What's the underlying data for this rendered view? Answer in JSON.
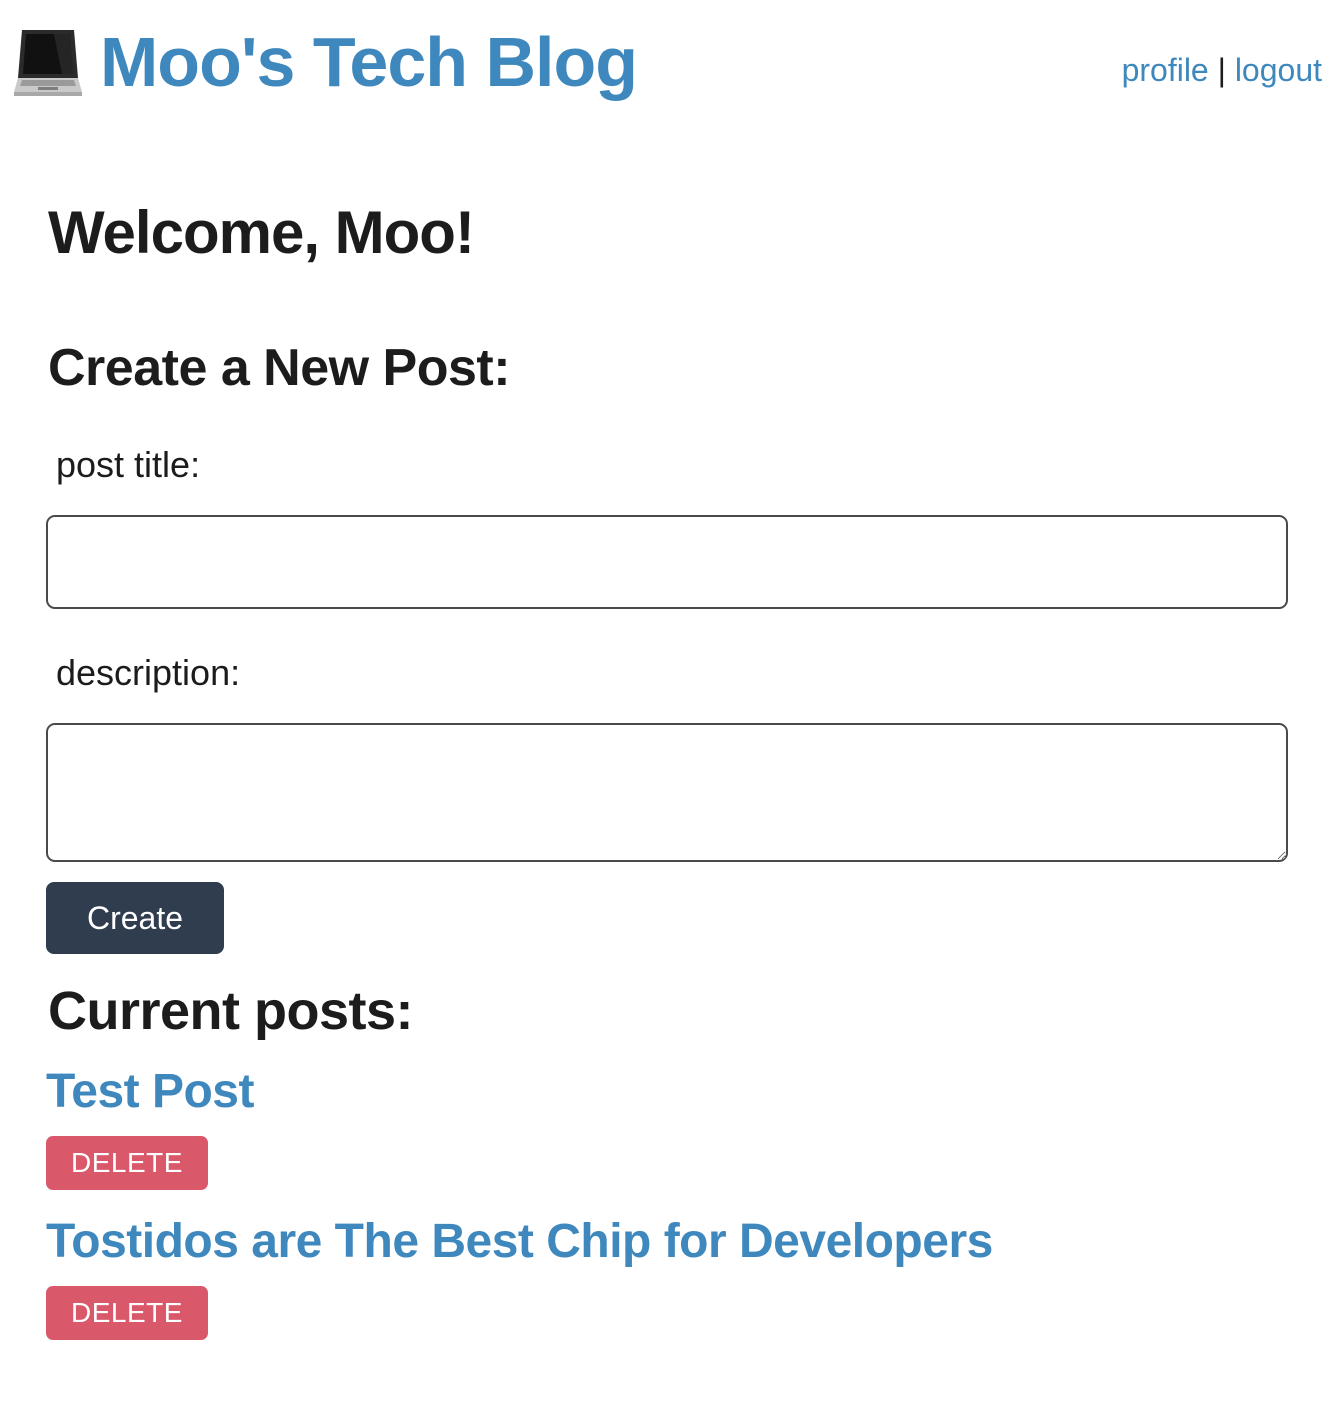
{
  "header": {
    "site_title": "Moo's Tech Blog",
    "logo_icon": "laptop-icon",
    "nav": {
      "profile_label": "profile",
      "separator": "|",
      "logout_label": "logout"
    }
  },
  "main": {
    "welcome": "Welcome, Moo!",
    "create_heading": "Create a New Post:",
    "form": {
      "title_label": "post title:",
      "title_value": "",
      "description_label": "description:",
      "description_value": "",
      "create_label": "Create"
    },
    "posts_heading": "Current posts:",
    "posts": [
      {
        "title": "Test Post",
        "delete_label": "DELETE"
      },
      {
        "title": "Tostidos are The Best Chip for Developers",
        "delete_label": "DELETE"
      }
    ]
  },
  "colors": {
    "link": "#3f88bd",
    "primary_button": "#2f3d4f",
    "delete_button": "#d9596a",
    "text": "#1c1c1c"
  }
}
